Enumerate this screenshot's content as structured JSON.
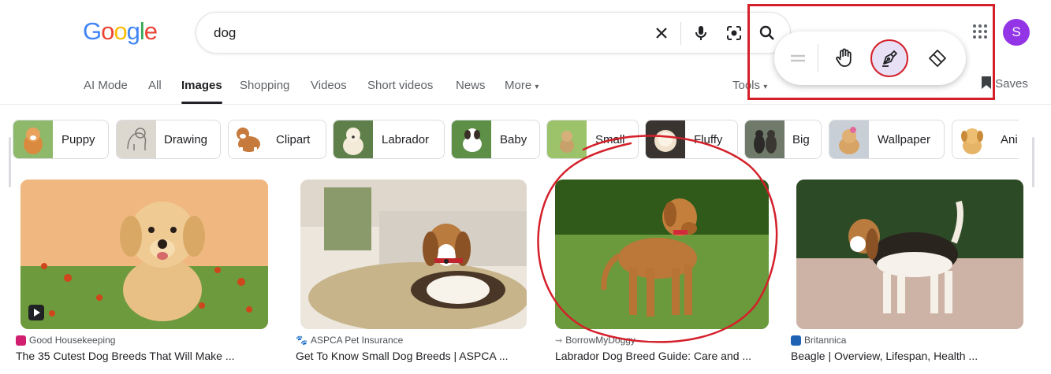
{
  "header": {
    "logo_letters": [
      "G",
      "o",
      "o",
      "g",
      "l",
      "e"
    ],
    "logo_colors": [
      "#4285f4",
      "#ea4335",
      "#fbbc05",
      "#4285f4",
      "#34a853",
      "#ea4335"
    ],
    "query": "dog",
    "avatar_initial": "S",
    "avatar_color": "#9334e6"
  },
  "tabs": [
    {
      "label": "AI Mode"
    },
    {
      "label": "All"
    },
    {
      "label": "Images",
      "active": true
    },
    {
      "label": "Shopping"
    },
    {
      "label": "Videos"
    },
    {
      "label": "Short videos"
    },
    {
      "label": "News"
    },
    {
      "label": "More"
    }
  ],
  "tools_label": "Tools",
  "saves_label": "Saves",
  "annotation_toolbar": {
    "tools": [
      "drag-handle",
      "hand-tool",
      "pen-tool",
      "eraser-tool"
    ],
    "selected": "pen-tool",
    "highlight_color": "#d4202a"
  },
  "chips": [
    {
      "label": "Puppy"
    },
    {
      "label": "Drawing"
    },
    {
      "label": "Clipart"
    },
    {
      "label": "Labrador"
    },
    {
      "label": "Baby"
    },
    {
      "label": "Small"
    },
    {
      "label": "Fluffy"
    },
    {
      "label": "Big"
    },
    {
      "label": "Wallpaper"
    },
    {
      "label": "Ani"
    }
  ],
  "results": [
    {
      "source": "Good Housekeeping",
      "title": "The 35 Cutest Dog Breeds That Will Make ...",
      "has_video": true
    },
    {
      "source": "ASPCA Pet Insurance",
      "title": "Get To Know Small Dog Breeds | ASPCA ..."
    },
    {
      "source": "BorrowMyDoggy",
      "title": "Labrador Dog Breed Guide: Care and ..."
    },
    {
      "source": "Britannica",
      "title": "Beagle | Overview, Lifespan, Health ..."
    }
  ]
}
